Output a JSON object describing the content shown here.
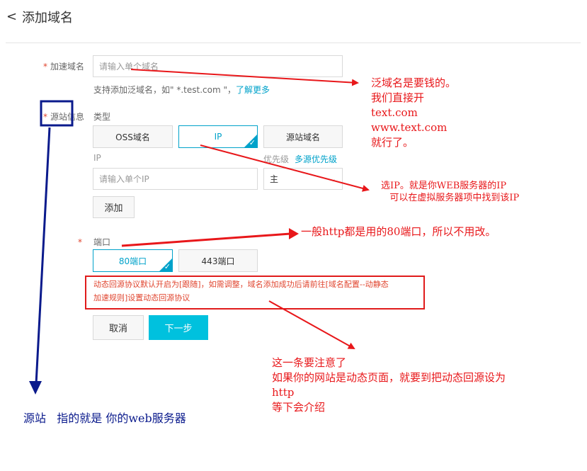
{
  "header": {
    "back_glyph": "<",
    "title": "添加域名"
  },
  "form": {
    "domain": {
      "required_mark": "*",
      "label": "加速域名",
      "placeholder": "请输入单个域名",
      "hint_prefix": "支持添加泛域名，如\" *.test.com \"，",
      "hint_link": "了解更多"
    },
    "origin": {
      "required_mark": "*",
      "label": "源站信息",
      "type_label": "类型",
      "types": [
        "OSS域名",
        "IP",
        "源站域名"
      ],
      "selected_type": "IP",
      "ip_label": "IP",
      "priority_label": "优先级",
      "priority_link": "多源优先级",
      "ip_placeholder": "请输入单个IP",
      "priority_value": "主",
      "add_button": "添加"
    },
    "port": {
      "required_mark": "*",
      "label": "端口",
      "options": [
        "80端口",
        "443端口"
      ],
      "selected": "80端口"
    },
    "notice": {
      "line1": "动态回源协议默认开启为[跟随]，如需调整，域名添加成功后请前往[域名配置--动静态",
      "line2": "加速规则]设置动态回源协议"
    },
    "buttons": {
      "cancel": "取消",
      "next": "下一步"
    }
  },
  "annotations": {
    "wildcard": "泛域名是要钱的。\n我们直接开\ntext.com\nwww.text.com\n就行了。",
    "ip": "选IP。就是你WEB服务器的IP\n   可以在虚拟服务器项中找到该IP",
    "port": "一般http都是用的80端口，所以不用改。",
    "dynamic": "这一条要注意了\n如果你的网站是动态页面，就要到把动态回源设为\nhttp\n等下会介绍",
    "origin": "源站   指的就是 你的web服务器"
  },
  "colors": {
    "annotation_red": "#e8171a",
    "annotation_blue": "#0a1a8c",
    "accent": "#00a2ca",
    "primary_button": "#00c1de"
  }
}
